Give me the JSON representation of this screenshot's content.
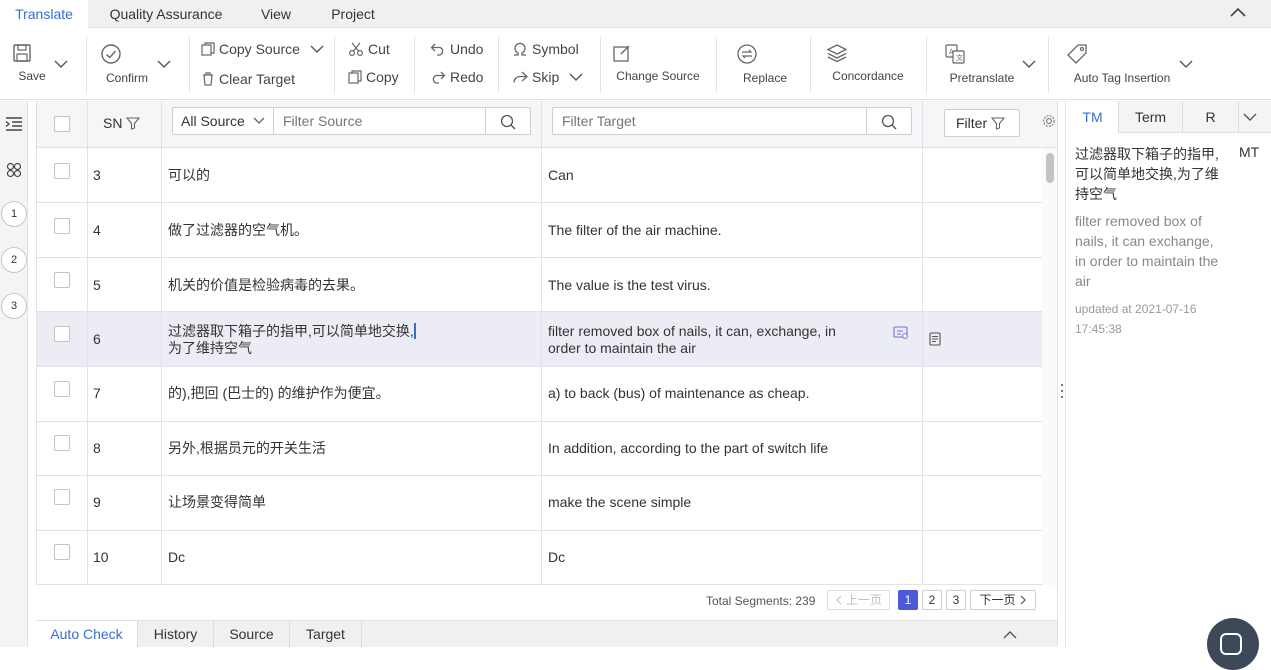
{
  "menu": {
    "tabs": [
      {
        "label": "Translate",
        "active": true
      },
      {
        "label": "Quality Assurance"
      },
      {
        "label": "View"
      },
      {
        "label": "Project"
      }
    ]
  },
  "toolbar": {
    "save": "Save",
    "confirm": "Confirm",
    "copy_source": "Copy Source",
    "clear_target": "Clear Target",
    "cut": "Cut",
    "copy": "Copy",
    "undo": "Undo",
    "redo": "Redo",
    "symbol": "Symbol",
    "skip": "Skip",
    "change_source": "Change Source",
    "replace": "Replace",
    "concordance": "Concordance",
    "pretranslate": "Pretranslate",
    "auto_tag_insertion": "Auto Tag Insertion"
  },
  "rail": {
    "steps": [
      "1",
      "2",
      "3"
    ]
  },
  "grid": {
    "sn_header": "SN",
    "source_filter_select": "All Source",
    "source_filter_placeholder": "Filter Source",
    "target_filter_placeholder": "Filter Target",
    "filter_button": "Filter",
    "rows": [
      {
        "sn": "3",
        "source": "可以的",
        "target": "Can"
      },
      {
        "sn": "4",
        "source": "做了过滤器的空气机。",
        "target": "The filter of the air machine."
      },
      {
        "sn": "5",
        "source": "机关的价值是检验病毒的去果。",
        "target": "The value is the test virus."
      },
      {
        "sn": "6",
        "source_line1": "过滤器取下箱子的指甲,可以简单地交换,",
        "source_line2": "为了维持空气",
        "target_line1": "filter removed box of nails, it can, exchange, in",
        "target_line2": "order to maintain the air",
        "selected": true
      },
      {
        "sn": "7",
        "source": "的),把回 (巴士的) 的维护作为便宜。",
        "target": "a) to back (bus) of maintenance as cheap."
      },
      {
        "sn": "8",
        "source": "另外,根据员元的开关生活",
        "target": "In addition, according to the part of switch life"
      },
      {
        "sn": "9",
        "source": "让场景变得简单",
        "target": "make the scene simple"
      },
      {
        "sn": "10",
        "source": "Dc",
        "target": "Dc"
      }
    ]
  },
  "pager": {
    "total": "Total Segments: 239",
    "prev": "上一页",
    "pages": [
      "1",
      "2",
      "3"
    ],
    "current": "1",
    "next": "下一页"
  },
  "bottom_tabs": [
    {
      "label": "Auto Check",
      "active": true
    },
    {
      "label": "History"
    },
    {
      "label": "Source"
    },
    {
      "label": "Target"
    }
  ],
  "right_panel": {
    "tabs": [
      {
        "label": "TM",
        "active": true
      },
      {
        "label": "Term"
      },
      {
        "label": "R"
      }
    ],
    "tm_source": "过滤器取下箱子的指甲,可以简单地交换,为了维持空气",
    "tm_match": "MT",
    "tm_target": "filter removed box of nails, it can exchange, in order to maintain the air",
    "tm_updated": "updated at 2021-07-16 17:45:38"
  },
  "colors": {
    "accent": "#3a6cd8",
    "page_active": "#4d59d6",
    "selected_row": "#ececf4"
  }
}
